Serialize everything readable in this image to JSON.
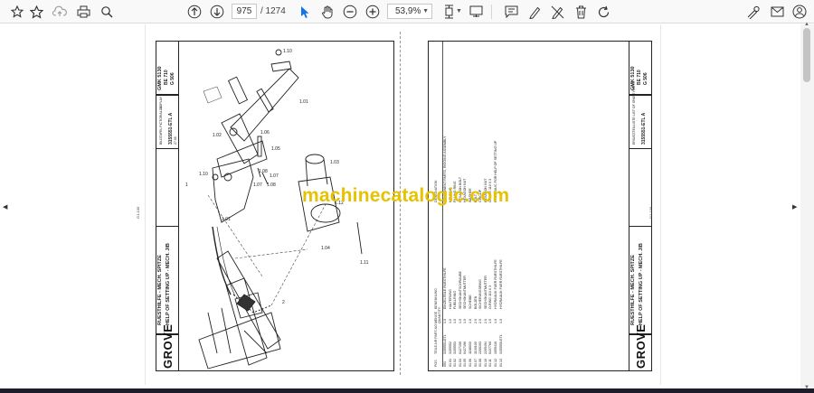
{
  "toolbar": {
    "page_current": "975",
    "page_total": "/ 1274",
    "zoom": "53,9%"
  },
  "left_sheet": {
    "brand": "GROVE",
    "title_de": "RUESTHILFE - MECH. SPITZE",
    "title_en": "HELP OF SETTING UP - MECH. JIB",
    "part_no": "3155551-ETL A",
    "model": "GMK 5130",
    "model_sub": "BE 710",
    "sheet": "G 506",
    "header_small": "BILDTAFEL  PICTORIAL DISPLAY",
    "scale": "1/1",
    "date": "27.06",
    "col_pos": "POS",
    "col_part": "TEILE-NR PART-NO",
    "col_qty": "MENGE QUANTITY",
    "col_desc": "BENENNUNG",
    "rows": [
      {
        "pos": "001",
        "part": "3155551-ETL",
        "qty": "1.0",
        "desc": "EINZELTEILE RUESTHILFE"
      },
      {
        "pos": "01.01",
        "part": "3155552",
        "qty": "1.0",
        "desc": "HALTERUNG"
      },
      {
        "pos": "01.02",
        "part": "3155553",
        "qty": "1.0",
        "desc": "FUELLRING"
      },
      {
        "pos": "01.03",
        "part": "0427195",
        "qty": "1.0",
        "desc": "SECHSKANTSCHRAUBE"
      },
      {
        "pos": "01.05",
        "part": "0427196",
        "qty": "1.0",
        "desc": "SECHSKANTMUTTER"
      },
      {
        "pos": "01.06",
        "part": "1188030",
        "qty": "1.0",
        "desc": "SCHEIBE"
      },
      {
        "pos": "01.07",
        "part": "1130100",
        "qty": "2.0",
        "desc": "BOLZEN"
      },
      {
        "pos": "01.08",
        "part": "2205193",
        "qty": "2.0",
        "desc": "SICHERUNGSRING"
      },
      {
        "pos": "01.10",
        "part": "2205494",
        "qty": "2.0",
        "desc": "SECHSKANTMUTTER"
      },
      {
        "pos": "01.11",
        "part": "0437760",
        "qty": "1.0",
        "desc": "O-RING 110 X 3"
      },
      {
        "pos": "01.12",
        "part": "1055416",
        "qty": "1.0",
        "desc": "HYDRAULIK FUER RUESTHILFE"
      },
      {
        "pos": "01.13",
        "part": "3155556-ETL",
        "qty": "1.0",
        "desc": "HYDRAULIK FUER RUESTHILFE"
      }
    ]
  },
  "right_sheet": {
    "brand": "GROVE",
    "title_de": "RUESTHILFE - MECH. SPITZE",
    "title_en": "HELP OF SETTING UP - MECH. JIB",
    "part_no": "3155551-ETL A",
    "model": "GMK 5130",
    "model_sub": "BE 710",
    "sheet": "G 506",
    "header_small": "ERSATZTEILLISTE  LIST OF SPARE PARTS",
    "col_desc": "DESIGNATION",
    "rows_en": [
      "COMPONENT PARTS, RIGGING ASSEMBLY",
      "HOLDING",
      "FILLING RING",
      "HEXAGON BOLT",
      "HEXAGON NUT",
      "WASHER",
      "BOLT",
      "CIRCLIP",
      "HEXAGON NUT",
      "O-RING 110 X 3",
      "HYDRAULIC FOR HELP OF SETTING UP"
    ]
  },
  "callouts": [
    "1.10",
    "1.01",
    "1.08",
    "1.05",
    "1.07",
    "1.02",
    "1.06",
    "1.03",
    "1.12",
    "1.11",
    "1.09",
    "1.04",
    "1.01",
    "1"
  ],
  "page_marks": {
    "left": "G1-106",
    "right": "G1-106"
  },
  "watermark": "machinecatalogic.com"
}
